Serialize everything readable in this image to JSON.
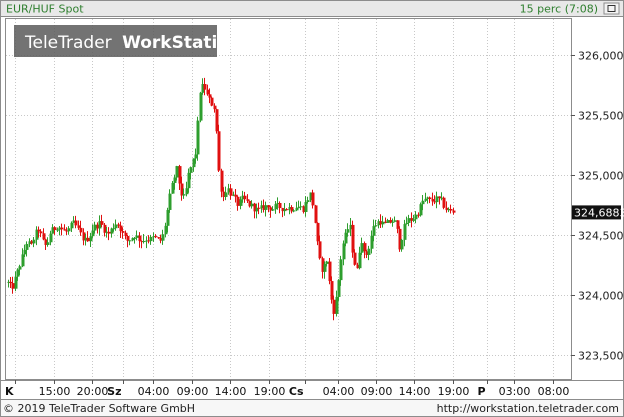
{
  "header": {
    "instrument": "EUR/HUF Spot",
    "interval": "15 perc (7:08)"
  },
  "watermark": {
    "brand_light": "TeleTrader",
    "brand_bold": "WorkStation"
  },
  "footer": {
    "copyright": "© 2019 TeleTrader Software GmbH",
    "url": "http://workstation.teletrader.com"
  },
  "colors": {
    "up": "#2e9e2e",
    "down": "#e01010",
    "grid": "#c8c8c8",
    "header_bg": "#e8e8e8",
    "header_text_left": "#2f7f2f",
    "header_text_right": "#2f7f2f",
    "price_tag_bg": "#111111",
    "price_tag_text": "#ffffff"
  },
  "chart_data": {
    "type": "candlestick",
    "title": "EUR/HUF Spot",
    "interval": "15 perc (7:08)",
    "last_price": "324,6883",
    "ylim": [
      323.3,
      326.3
    ],
    "y_ticks": [
      "326,0000",
      "325,5000",
      "325,0000",
      "324,5000",
      "324,0000",
      "323,5000"
    ],
    "y_tick_values": [
      326.0,
      325.5,
      325.0,
      324.5,
      324.0,
      323.5
    ],
    "x_tick_labels": [
      {
        "label": "K",
        "day": true,
        "t": 0.0
      },
      {
        "label": "15:00",
        "day": false,
        "t": 5.0
      },
      {
        "label": "20:00",
        "day": false,
        "t": 10.0
      },
      {
        "label": "Sz",
        "day": true,
        "t": 14.0
      },
      {
        "label": "04:00",
        "day": false,
        "t": 18.0
      },
      {
        "label": "09:00",
        "day": false,
        "t": 23.0
      },
      {
        "label": "14:00",
        "day": false,
        "t": 28.0
      },
      {
        "label": "19:00",
        "day": false,
        "t": 33.0
      },
      {
        "label": "Cs",
        "day": true,
        "t": 37.7
      },
      {
        "label": "04:00",
        "day": false,
        "t": 42.0
      },
      {
        "label": "09:00",
        "day": false,
        "t": 47.0
      },
      {
        "label": "14:00",
        "day": false,
        "t": 52.0
      },
      {
        "label": "19:00",
        "day": false,
        "t": 57.0
      },
      {
        "label": "P",
        "day": true,
        "t": 61.5
      },
      {
        "label": "03:00",
        "day": false,
        "t": 65.0
      },
      {
        "label": "08:00",
        "day": false,
        "t": 70.0
      }
    ],
    "t_range": [
      -1.2,
      72.4
    ],
    "price_path": [
      [
        -1.0,
        324.1
      ],
      [
        -0.5,
        324.05
      ],
      [
        0.0,
        324.15
      ],
      [
        0.5,
        324.25
      ],
      [
        1.0,
        324.35
      ],
      [
        1.5,
        324.45
      ],
      [
        2.0,
        324.4
      ],
      [
        2.5,
        324.5
      ],
      [
        3.0,
        324.55
      ],
      [
        3.5,
        324.45
      ],
      [
        4.0,
        324.4
      ],
      [
        4.5,
        324.52
      ],
      [
        5.0,
        324.55
      ],
      [
        5.5,
        324.58
      ],
      [
        6.0,
        324.55
      ],
      [
        6.5,
        324.52
      ],
      [
        7.0,
        324.55
      ],
      [
        7.5,
        324.6
      ],
      [
        8.0,
        324.56
      ],
      [
        8.5,
        324.5
      ],
      [
        9.0,
        324.45
      ],
      [
        9.5,
        324.48
      ],
      [
        10.0,
        324.55
      ],
      [
        10.5,
        324.58
      ],
      [
        11.0,
        324.6
      ],
      [
        11.5,
        324.55
      ],
      [
        12.0,
        324.5
      ],
      [
        12.5,
        324.55
      ],
      [
        13.0,
        324.6
      ],
      [
        13.5,
        324.58
      ],
      [
        14.0,
        324.5
      ],
      [
        14.5,
        324.45
      ],
      [
        15.0,
        324.47
      ],
      [
        15.5,
        324.5
      ],
      [
        16.0,
        324.47
      ],
      [
        16.5,
        324.45
      ],
      [
        17.0,
        324.47
      ],
      [
        17.5,
        324.46
      ],
      [
        18.0,
        324.48
      ],
      [
        18.5,
        324.46
      ],
      [
        19.0,
        324.45
      ],
      [
        19.5,
        324.6
      ],
      [
        20.0,
        324.8
      ],
      [
        20.5,
        324.95
      ],
      [
        21.0,
        325.05
      ],
      [
        21.5,
        324.85
      ],
      [
        22.0,
        324.8
      ],
      [
        22.5,
        325.0
      ],
      [
        23.0,
        325.1
      ],
      [
        23.5,
        325.2
      ],
      [
        24.0,
        325.7
      ],
      [
        24.5,
        325.75
      ],
      [
        25.0,
        325.65
      ],
      [
        25.5,
        325.6
      ],
      [
        26.0,
        325.55
      ],
      [
        26.5,
        325.0
      ],
      [
        27.0,
        324.8
      ],
      [
        27.5,
        324.9
      ],
      [
        28.0,
        324.85
      ],
      [
        28.5,
        324.8
      ],
      [
        29.0,
        324.75
      ],
      [
        29.5,
        324.8
      ],
      [
        30.0,
        324.78
      ],
      [
        30.5,
        324.75
      ],
      [
        31.0,
        324.73
      ],
      [
        31.5,
        324.7
      ],
      [
        32.0,
        324.72
      ],
      [
        32.5,
        324.74
      ],
      [
        33.0,
        324.73
      ],
      [
        33.5,
        324.72
      ],
      [
        34.0,
        324.74
      ],
      [
        34.5,
        324.73
      ],
      [
        35.0,
        324.72
      ],
      [
        35.5,
        324.73
      ],
      [
        36.0,
        324.72
      ],
      [
        36.5,
        324.74
      ],
      [
        37.0,
        324.73
      ],
      [
        37.5,
        324.72
      ],
      [
        38.0,
        324.8
      ],
      [
        38.5,
        324.85
      ],
      [
        39.0,
        324.6
      ],
      [
        39.5,
        324.3
      ],
      [
        40.0,
        324.2
      ],
      [
        40.5,
        324.3
      ],
      [
        41.0,
        324.0
      ],
      [
        41.5,
        323.85
      ],
      [
        42.0,
        324.1
      ],
      [
        42.5,
        324.4
      ],
      [
        43.0,
        324.5
      ],
      [
        43.5,
        324.6
      ],
      [
        44.0,
        324.3
      ],
      [
        44.5,
        324.2
      ],
      [
        45.0,
        324.5
      ],
      [
        45.5,
        324.3
      ],
      [
        46.0,
        324.4
      ],
      [
        46.5,
        324.55
      ],
      [
        47.0,
        324.6
      ],
      [
        47.5,
        324.62
      ],
      [
        48.0,
        324.58
      ],
      [
        48.5,
        324.6
      ],
      [
        49.0,
        324.62
      ],
      [
        49.5,
        324.6
      ],
      [
        50.0,
        324.4
      ],
      [
        50.5,
        324.55
      ],
      [
        51.0,
        324.62
      ],
      [
        51.5,
        324.63
      ],
      [
        52.0,
        324.65
      ],
      [
        52.5,
        324.7
      ],
      [
        53.0,
        324.78
      ],
      [
        53.5,
        324.8
      ],
      [
        54.0,
        324.78
      ],
      [
        54.5,
        324.79
      ],
      [
        55.0,
        324.8
      ],
      [
        55.5,
        324.78
      ],
      [
        56.0,
        324.72
      ],
      [
        56.5,
        324.7
      ],
      [
        57.0,
        324.69
      ]
    ],
    "last_marker_t": 57.0
  }
}
